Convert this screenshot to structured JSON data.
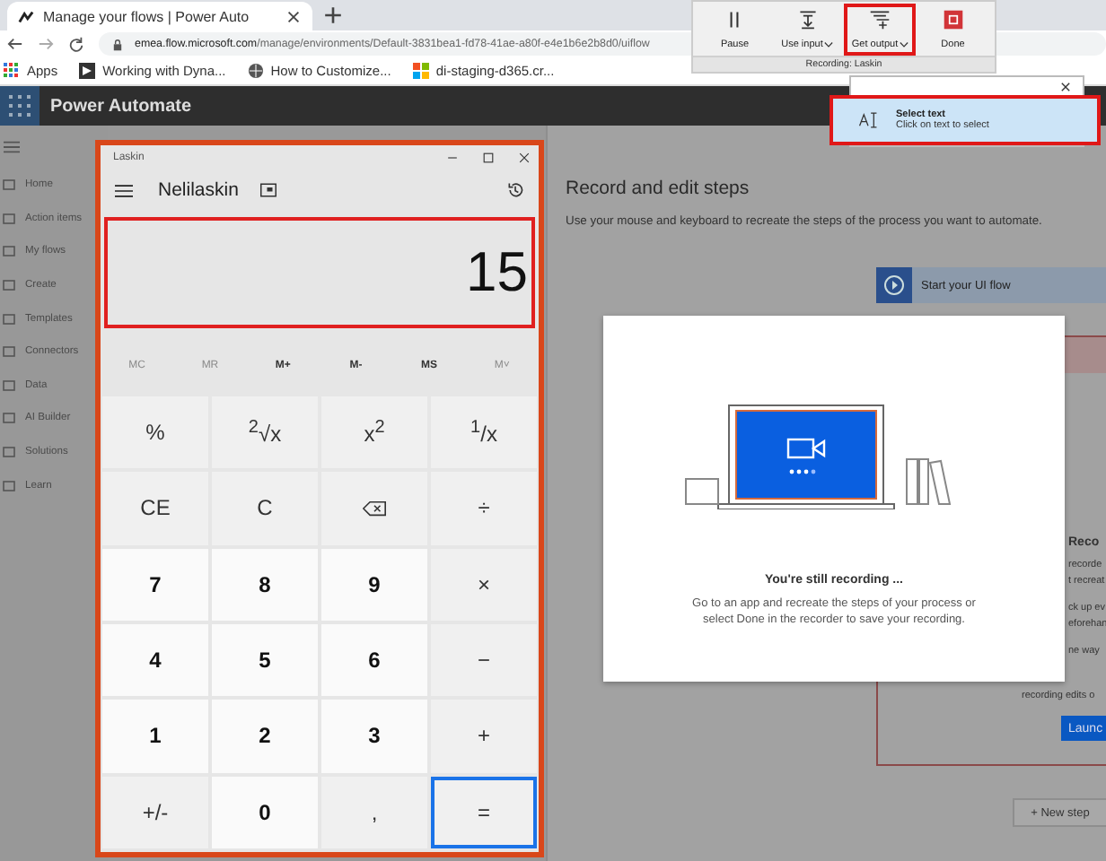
{
  "browser": {
    "tab_title": "Manage your flows | Power Auto",
    "address_host": "emea.flow.microsoft.com",
    "address_path": "/manage/environments/Default-3831bea1-fd78-41ae-a80f-e4e1b6e2b8d0/uiflow",
    "bookmarks": [
      {
        "label": "Apps",
        "kind": "apps"
      },
      {
        "label": "Working with Dyna...",
        "kind": "dyn"
      },
      {
        "label": "How to Customize...",
        "kind": "globe"
      },
      {
        "label": "di-staging-d365.cr...",
        "kind": "ms"
      }
    ]
  },
  "app": {
    "title": "Power Automate"
  },
  "sidebar": {
    "items": [
      {
        "label": "Home"
      },
      {
        "label": "Action items"
      },
      {
        "label": "My flows"
      },
      {
        "label": "Create"
      },
      {
        "label": "Templates"
      },
      {
        "label": "Connectors"
      },
      {
        "label": "Data"
      },
      {
        "label": "AI Builder"
      },
      {
        "label": "Solutions"
      },
      {
        "label": "Learn"
      }
    ]
  },
  "main": {
    "heading": "Record and edit steps",
    "description": "Use your mouse and keyboard to recreate the steps of the process you want to automate.",
    "start_step": "Start your UI flow",
    "panel_fragments": [
      "Reco",
      "recorde",
      "t recreat",
      "ck up ev",
      "eforehan",
      "ne way",
      "recording edits o"
    ],
    "panel_button": "Launc",
    "new_step": "+ New step"
  },
  "calculator": {
    "title": "Laskin",
    "mode": "Nelilaskin",
    "display": "15",
    "memory": [
      {
        "label": "MC",
        "disabled": true
      },
      {
        "label": "MR",
        "disabled": true
      },
      {
        "label": "M+",
        "disabled": false
      },
      {
        "label": "M-",
        "disabled": false
      },
      {
        "label": "MS",
        "disabled": false
      },
      {
        "label": "M˅",
        "disabled": true
      }
    ],
    "keys": [
      {
        "label": "%",
        "kind": "func",
        "focused": false
      },
      {
        "label": "$^{2}$√x",
        "kind": "func",
        "focused": false
      },
      {
        "label": "x$^{2}$",
        "kind": "func",
        "focused": false
      },
      {
        "label": "$^{1}$/x",
        "kind": "func",
        "focused": false
      },
      {
        "label": "CE",
        "kind": "func",
        "focused": false
      },
      {
        "label": "C",
        "kind": "func",
        "focused": false
      },
      {
        "kind": "backspace",
        "focused": false
      },
      {
        "label": "÷",
        "kind": "func",
        "focused": false
      },
      {
        "label": "7",
        "kind": "digit",
        "focused": false
      },
      {
        "label": "8",
        "kind": "digit",
        "focused": false
      },
      {
        "label": "9",
        "kind": "digit",
        "focused": false
      },
      {
        "label": "×",
        "kind": "func",
        "focused": false
      },
      {
        "label": "4",
        "kind": "digit",
        "focused": false
      },
      {
        "label": "5",
        "kind": "digit",
        "focused": false
      },
      {
        "label": "6",
        "kind": "digit",
        "focused": false
      },
      {
        "label": "−",
        "kind": "func",
        "focused": false
      },
      {
        "label": "1",
        "kind": "digit",
        "focused": false
      },
      {
        "label": "2",
        "kind": "digit",
        "focused": false
      },
      {
        "label": "3",
        "kind": "digit",
        "focused": false
      },
      {
        "label": "+",
        "kind": "func",
        "focused": false
      },
      {
        "label": "+/-",
        "kind": "func",
        "focused": false
      },
      {
        "label": "0",
        "kind": "digit",
        "focused": false
      },
      {
        "label": ",",
        "kind": "func",
        "focused": false
      },
      {
        "label": "=",
        "kind": "func",
        "focused": true
      }
    ]
  },
  "dialog": {
    "title": "You're still recording ...",
    "message": "Go to an app and recreate the steps of your process or select Done in the recorder to save your recording."
  },
  "recorder": {
    "buttons": [
      {
        "label": "Pause",
        "kind": "pause",
        "dropdown": false,
        "highlighted": false
      },
      {
        "label": "Use input",
        "kind": "input",
        "dropdown": true,
        "highlighted": false
      },
      {
        "label": "Get output",
        "kind": "output",
        "dropdown": true,
        "highlighted": true
      },
      {
        "label": "Done",
        "kind": "stop",
        "dropdown": false,
        "highlighted": false
      }
    ],
    "status": "Recording: Laskin"
  },
  "output_menu": {
    "items": [
      {
        "title": "Select text",
        "subtitle": "Click on text to select",
        "highlighted": true
      }
    ]
  }
}
